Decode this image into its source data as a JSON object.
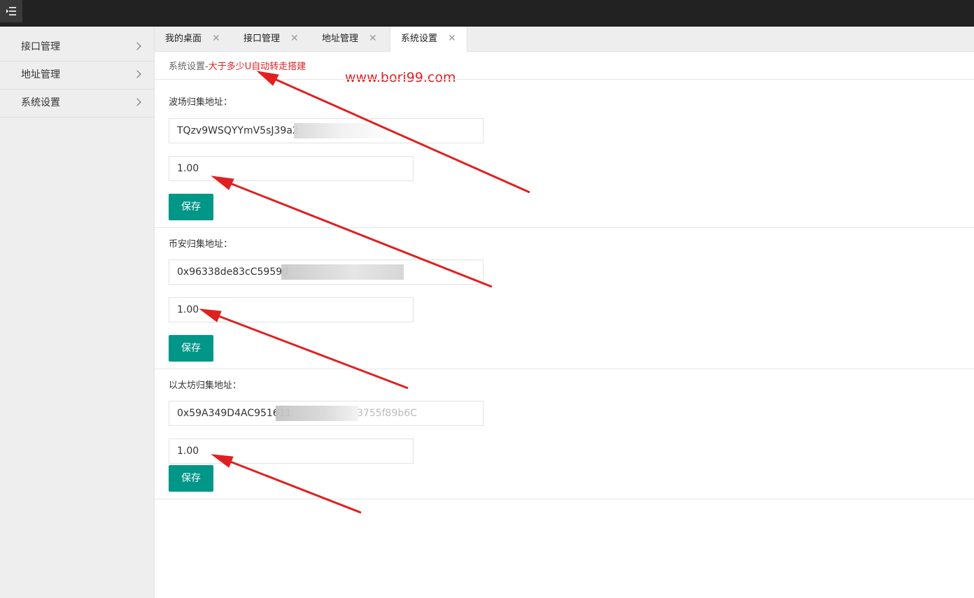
{
  "sidebar": {
    "items": [
      {
        "label": "接口管理"
      },
      {
        "label": "地址管理"
      },
      {
        "label": "系统设置"
      }
    ]
  },
  "tabs": [
    {
      "label": "我的桌面"
    },
    {
      "label": "接口管理"
    },
    {
      "label": "地址管理"
    },
    {
      "label": "系统设置",
      "active": true
    }
  ],
  "breadcrumb": {
    "prefix": "系统设置-",
    "highlight": "大于多少U自动转走搭建"
  },
  "watermark": "www.bori99.com",
  "sections": [
    {
      "label": "波场归集地址：",
      "address": "TQzv9WSQYYmV5sJ39a2",
      "amount": "1.00",
      "save_label": "保存"
    },
    {
      "label": "币安归集地址：",
      "address": "0x96338de83cC5959d",
      "amount": "1.00",
      "save_label": "保存"
    },
    {
      "label": "以太坊归集地址：",
      "address": "0x59A349D4AC951611",
      "address_tail": "3755f89b6C",
      "amount": "1.00",
      "save_label": "保存"
    }
  ],
  "colors": {
    "topbar": "#222222",
    "primary_button": "#009688",
    "annotation_red": "#e02020"
  }
}
